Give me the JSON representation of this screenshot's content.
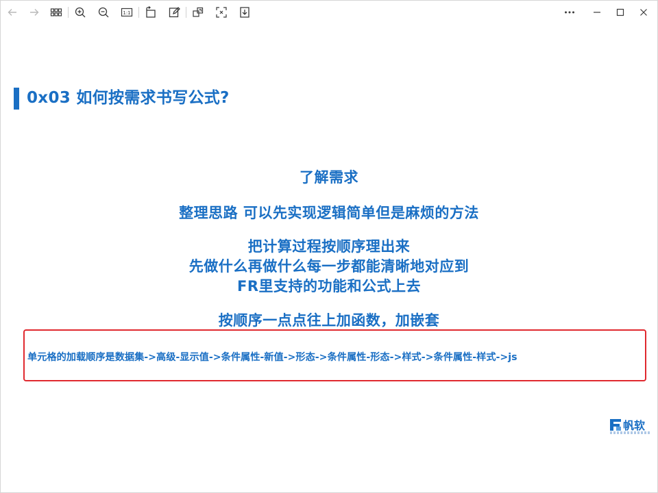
{
  "toolbar": {
    "icons": [
      "back-arrow-icon",
      "forward-arrow-icon",
      "thumbnails-grid-icon",
      "zoom-in-icon",
      "zoom-out-icon",
      "actual-size-icon",
      "rotate-icon",
      "edit-icon",
      "crop-icon",
      "fit-screen-icon",
      "download-icon"
    ],
    "actual_size_label": "1:1"
  },
  "window_controls": [
    "more-icon",
    "minimize-icon",
    "maximize-icon",
    "close-icon"
  ],
  "slide": {
    "title": "0x03 如何按需求书写公式?",
    "lines": [
      "了解需求",
      "整理思路 可以先实现逻辑简单但是麻烦的方法",
      "把计算过程按顺序理出来",
      "先做什么再做什么每一步都能清晰地对应到",
      "FR里支持的功能和公式上去",
      "按顺序一点点往上加函数，加嵌套"
    ],
    "highlight": "单元格的加载顺序是数据集->高级-显示值->条件属性-新值->形态->条件属性-形态->样式->条件属性-样式->js",
    "logo_text": "帆软"
  },
  "colors": {
    "accent": "#1a6fc4",
    "highlight_border": "#e0282e",
    "icon": "#3a3a3a",
    "icon_disabled": "#b9b9b9"
  }
}
